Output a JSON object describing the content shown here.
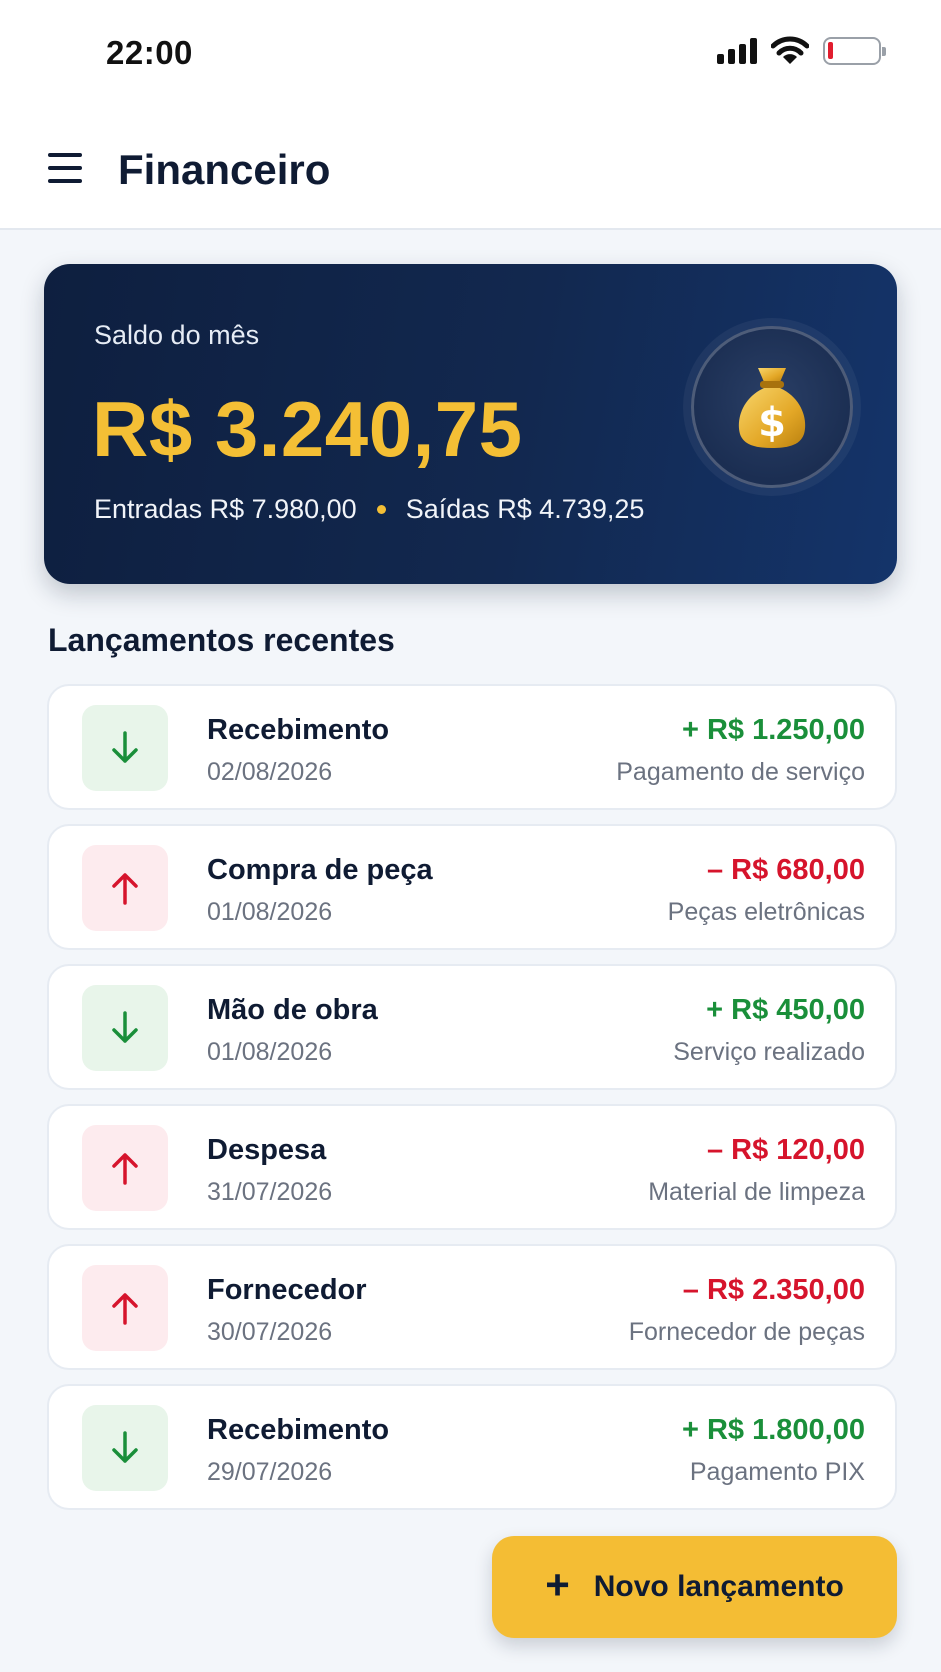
{
  "status_bar": {
    "time": "22:00",
    "icons": [
      "signal-icon",
      "wifi-icon",
      "battery-icon"
    ]
  },
  "header": {
    "title": "Financeiro",
    "menu_icon": "hamburger-menu-icon"
  },
  "balance": {
    "label": "Saldo do mês",
    "value": "R$ 3.240,75",
    "income": "Entradas R$ 7.980,00",
    "expenses": "Saídas R$ 4.739,25",
    "icon": "money-bag-icon",
    "accent_color": "#f4bf35"
  },
  "transactions_section": {
    "title": "Lançamentos recentes"
  },
  "transactions": [
    {
      "type": "in",
      "icon": "arrow-down-icon",
      "title": "Recebimento",
      "date": "02/08/2026",
      "amount": "+ R$ 1.250,00",
      "description": "Pagamento de serviço"
    },
    {
      "type": "out",
      "icon": "arrow-up-icon",
      "title": "Compra de peça",
      "date": "01/08/2026",
      "amount": "– R$ 680,00",
      "description": "Peças eletrônicas"
    },
    {
      "type": "in",
      "icon": "arrow-down-icon",
      "title": "Mão de obra",
      "date": "01/08/2026",
      "amount": "+ R$ 450,00",
      "description": "Serviço realizado"
    },
    {
      "type": "out",
      "icon": "arrow-up-icon",
      "title": "Despesa",
      "date": "31/07/2026",
      "amount": "– R$ 120,00",
      "description": "Material de limpeza"
    },
    {
      "type": "out",
      "icon": "arrow-up-icon",
      "title": "Fornecedor",
      "date": "30/07/2026",
      "amount": "– R$ 2.350,00",
      "description": "Fornecedor de peças"
    },
    {
      "type": "in",
      "icon": "arrow-down-icon",
      "title": "Recebimento",
      "date": "29/07/2026",
      "amount": "+ R$ 1.800,00",
      "description": "Pagamento PIX"
    }
  ],
  "fab": {
    "plus": "+",
    "label": "Novo lançamento"
  },
  "colors": {
    "income": "#1a8f3a",
    "expense": "#d6142c",
    "primary_dark": "#0f1b33",
    "fab": "#f4bd34"
  }
}
